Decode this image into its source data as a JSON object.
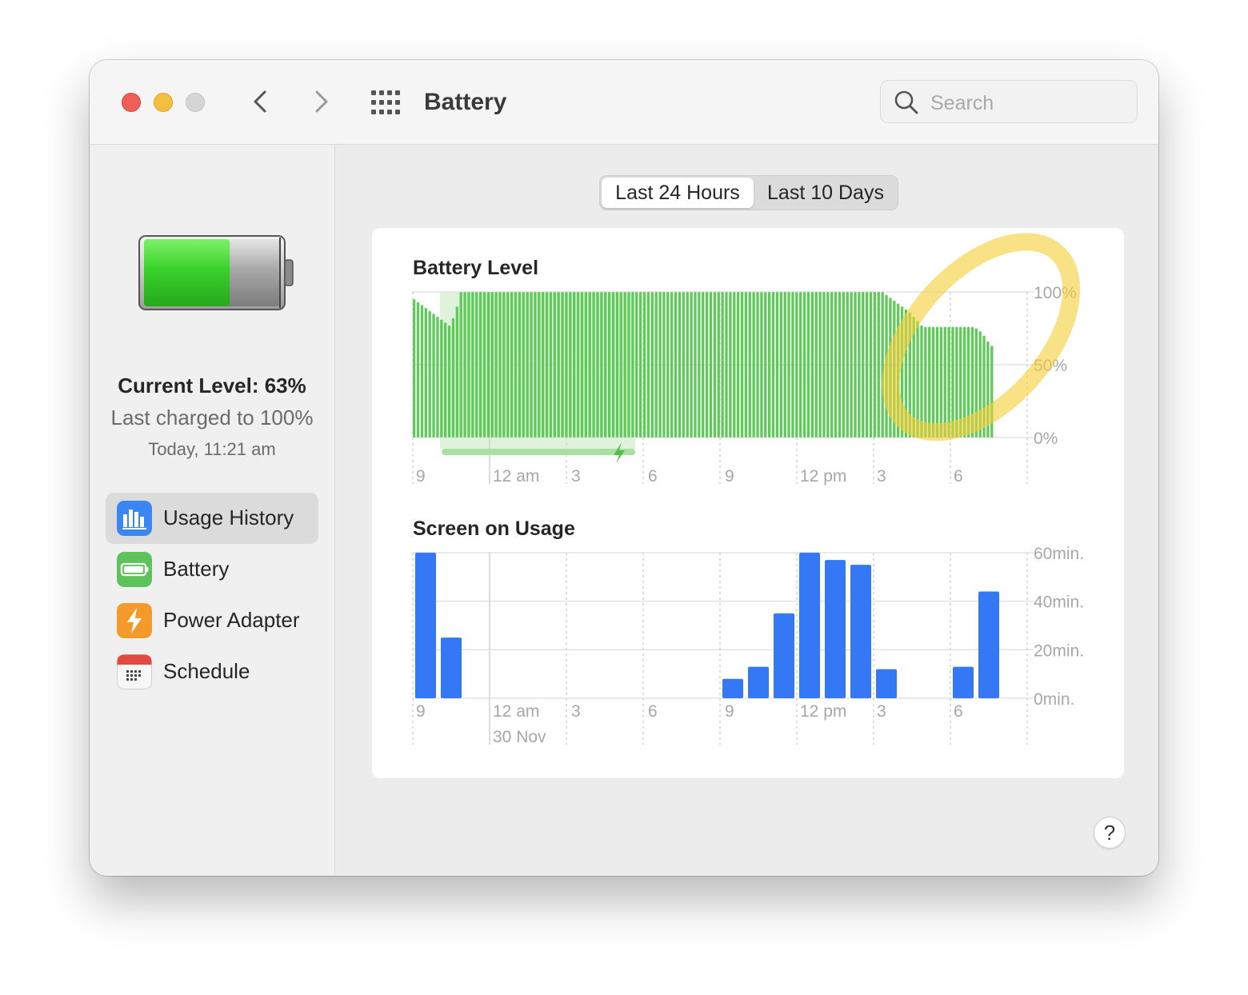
{
  "window": {
    "title": "Battery",
    "search": {
      "placeholder": "Search",
      "value": ""
    }
  },
  "sidebar": {
    "current_level": "Current Level: 63%",
    "last_charged": "Last charged to 100%",
    "charged_time": "Today, 11:21 am",
    "battery_level_fraction": 0.63,
    "items": [
      {
        "label": "Usage History",
        "icon": "usage-history-icon",
        "selected": true
      },
      {
        "label": "Battery",
        "icon": "battery-icon",
        "selected": false
      },
      {
        "label": "Power Adapter",
        "icon": "power-adapter-icon",
        "selected": false
      },
      {
        "label": "Schedule",
        "icon": "schedule-icon",
        "selected": false
      }
    ]
  },
  "segmented": {
    "options": [
      "Last 24 Hours",
      "Last 10 Days"
    ],
    "selected": "Last 24 Hours"
  },
  "help_label": "?",
  "colors": {
    "battery_bar": "#5fc95a",
    "charging_band": "#dff3dc",
    "charging_line": "#a8e0a2",
    "screen_bar": "#3478f6",
    "highlight_circle": "#f5cf3c"
  },
  "chart_data": [
    {
      "type": "bar",
      "title": "Battery Level",
      "y_tick_labels": [
        "100%",
        "50%",
        "0%"
      ],
      "ylim": [
        0,
        100
      ],
      "x_tick_labels": [
        "9",
        "12 am",
        "3",
        "6",
        "9",
        "12 pm",
        "3",
        "6"
      ],
      "x_tick_dashed": [
        true,
        false,
        true,
        true,
        true,
        true,
        true,
        true
      ],
      "charging_interval_bar_index": [
        7,
        57
      ],
      "values": [
        95,
        93,
        91,
        89,
        87,
        85,
        83,
        81,
        79,
        77,
        82,
        90,
        100,
        100,
        100,
        100,
        100,
        100,
        100,
        100,
        100,
        100,
        100,
        100,
        100,
        100,
        100,
        100,
        100,
        100,
        100,
        100,
        100,
        100,
        100,
        100,
        100,
        100,
        100,
        100,
        100,
        100,
        100,
        100,
        100,
        100,
        100,
        100,
        100,
        100,
        100,
        100,
        100,
        100,
        100,
        100,
        100,
        100,
        100,
        100,
        100,
        100,
        100,
        100,
        100,
        100,
        100,
        100,
        100,
        100,
        100,
        100,
        100,
        100,
        100,
        100,
        100,
        100,
        100,
        100,
        100,
        100,
        100,
        100,
        100,
        100,
        100,
        100,
        100,
        100,
        100,
        100,
        100,
        100,
        100,
        100,
        100,
        100,
        100,
        100,
        100,
        100,
        100,
        100,
        100,
        100,
        100,
        100,
        100,
        100,
        100,
        100,
        100,
        100,
        100,
        100,
        100,
        100,
        100,
        100,
        100,
        98,
        96,
        94,
        92,
        90,
        88,
        86,
        83,
        80,
        77,
        76,
        76,
        76,
        76,
        76,
        76,
        76,
        76,
        76,
        76,
        76,
        76,
        76,
        75,
        73,
        70,
        66,
        63
      ],
      "annotation": "yellow-highlight-circle"
    },
    {
      "type": "bar",
      "title": "Screen on Usage",
      "y_tick_labels": [
        "60min.",
        "40min.",
        "20min.",
        "0min."
      ],
      "ylim": [
        0,
        60
      ],
      "x_tick_labels": [
        "9",
        "12 am",
        "3",
        "6",
        "9",
        "12 pm",
        "3",
        "6"
      ],
      "x_tick_dashed": [
        true,
        false,
        true,
        true,
        true,
        true,
        true,
        true
      ],
      "date_label": "30 Nov",
      "values": [
        60,
        25,
        0,
        0,
        0,
        0,
        0,
        0,
        0,
        0,
        0,
        0,
        8,
        13,
        35,
        60,
        57,
        55,
        12,
        0,
        0,
        13,
        44
      ]
    }
  ]
}
